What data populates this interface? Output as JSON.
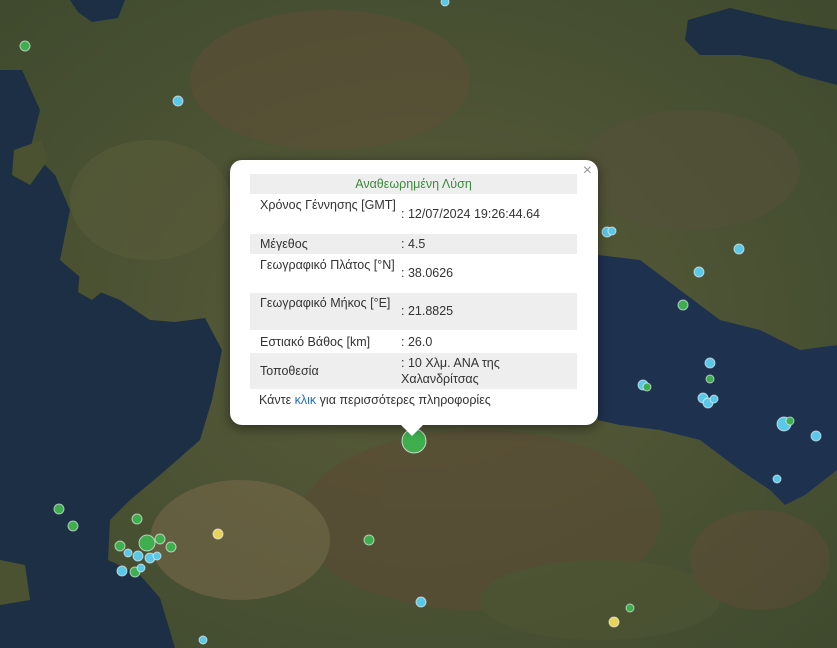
{
  "popup": {
    "title": "Αναθεωρημένη Λύση",
    "close_symbol": "×",
    "rows": [
      {
        "label": "Χρόνος Γέννησης [GMT]",
        "value": ": 12/07/2024 19:26:44.64"
      },
      {
        "label": "Μέγεθος",
        "value": ": 4.5"
      },
      {
        "label": "Γεωγραφικό Πλάτος [°N]",
        "value": ": 38.0626"
      },
      {
        "label": "Γεωγραφικό Μήκος [°E]",
        "value": ": 21.8825"
      },
      {
        "label": "Εστιακό Βάθος [km]",
        "value": ": 26.0"
      },
      {
        "label": "Τοποθεσία",
        "value": ": 10 Χλμ. ΑΝΑ της Χαλανδρίτσας"
      }
    ],
    "footer_before": "Κάντε ",
    "footer_link": "κλικ",
    "footer_after": " για περισσότερες πληροφορίες"
  },
  "colors": {
    "sea": "#1c2f44",
    "land": "#4a5233",
    "marker_green": "#3fae4f",
    "marker_cyan": "#5bc8e8",
    "marker_yellow": "#e8d35a",
    "popup_title": "#3c8a3c",
    "link": "#1f6fbf"
  },
  "icons": {
    "close": "close-icon",
    "selected_event": "earthquake-marker-icon"
  }
}
